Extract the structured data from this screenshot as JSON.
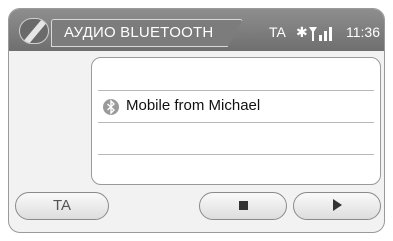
{
  "header": {
    "title": "АУДИО BLUETOOTH",
    "ta_indicator": "TA",
    "bluetooth_symbol": "✱",
    "time": "11:36"
  },
  "device_list": {
    "items": [
      {
        "label": "Mobile from Michael",
        "icon": "bluetooth-icon"
      }
    ]
  },
  "bottom_bar": {
    "ta_label": "TA",
    "stop_icon": "stop-icon",
    "play_icon": "play-icon"
  },
  "colors": {
    "header_bg": "#7c7c7c",
    "screen_bg": "#f2f2f2",
    "list_bg": "#ffffff"
  }
}
